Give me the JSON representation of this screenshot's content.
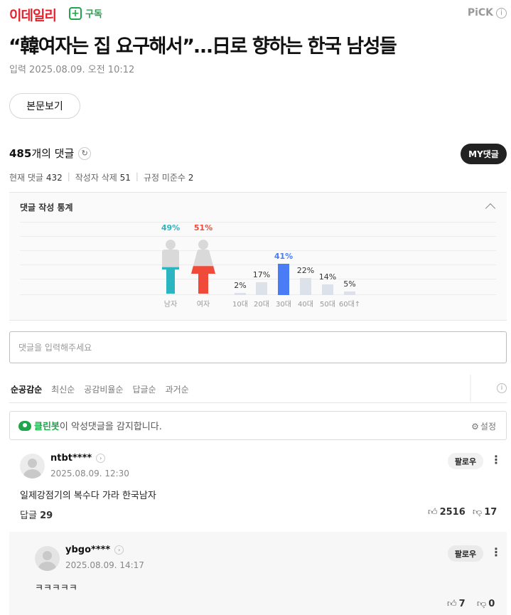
{
  "header": {
    "brand": "이데일리",
    "subscribe_label": "구독",
    "pick_label": "PiCK",
    "pick_info": "i"
  },
  "article": {
    "title": "“韓여자는 집 요구해서”…日로 향하는 한국 남성들",
    "dateline": "입력 2025.08.09. 오전 10:12",
    "view_body_label": "본문보기"
  },
  "comments_header": {
    "count_number": "485",
    "count_suffix": "개의 댓글",
    "refresh_icon": "↻",
    "my_comments_label": "MY댓글",
    "current_label": "현재 댓글",
    "current_value": "432",
    "deleted_label": "작성자 삭제",
    "deleted_value": "51",
    "violation_label": "규정 미준수",
    "violation_value": "2"
  },
  "stats": {
    "title": "댓글 작성 통계",
    "gender": [
      {
        "label": "남자",
        "percent_text": "49%",
        "value": 49,
        "color": "#2bb5c0"
      },
      {
        "label": "여자",
        "percent_text": "51%",
        "value": 51,
        "color": "#f04a3a"
      }
    ],
    "age": [
      {
        "label": "10대",
        "percent_text": "2%",
        "value": 2,
        "highlight": false
      },
      {
        "label": "20대",
        "percent_text": "17%",
        "value": 17,
        "highlight": false
      },
      {
        "label": "30대",
        "percent_text": "41%",
        "value": 41,
        "highlight": true
      },
      {
        "label": "40대",
        "percent_text": "22%",
        "value": 22,
        "highlight": false
      },
      {
        "label": "50대",
        "percent_text": "14%",
        "value": 14,
        "highlight": false
      },
      {
        "label": "60대↑",
        "percent_text": "5%",
        "value": 5,
        "highlight": false
      }
    ],
    "highlight_color": "#4a7cf5"
  },
  "input": {
    "placeholder": "댓글을 입력해주세요"
  },
  "sort_tabs": [
    "순공감순",
    "최신순",
    "공감비율순",
    "답글순",
    "과거순"
  ],
  "cleanbot": {
    "name": "클린봇",
    "message": "이 악성댓글을 감지합니다.",
    "settings_label": "설정"
  },
  "comments": [
    {
      "user": "ntbt****",
      "date": "2025.08.09. 12:30",
      "text": "일제강점기의 복수다 가라 한국남자",
      "reply_label": "답글",
      "reply_count": "29",
      "likes": "2516",
      "dislikes": "17",
      "follow_label": "팔로우"
    }
  ],
  "reply": {
    "user": "ybgo****",
    "date": "2025.08.09. 14:17",
    "text": "ㅋㅋㅋㅋㅋ",
    "likes": "7",
    "dislikes": "0",
    "follow_label": "팔로우"
  }
}
